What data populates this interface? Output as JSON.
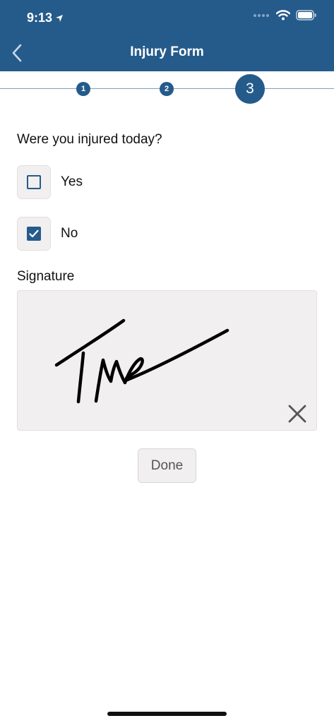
{
  "status_bar": {
    "time": "9:13"
  },
  "nav": {
    "title": "Injury Form"
  },
  "stepper": {
    "steps": [
      "1",
      "2",
      "3"
    ],
    "current_step": 3
  },
  "form": {
    "question": "Were you injured today?",
    "options": [
      {
        "label": "Yes",
        "checked": false
      },
      {
        "label": "No",
        "checked": true
      }
    ],
    "signature_label": "Signature",
    "done_label": "Done"
  },
  "colors": {
    "brand": "#255b8b",
    "field_bg": "#f1efef"
  },
  "icons": {
    "back": "chevron-left-icon",
    "location": "location-arrow-icon",
    "wifi": "wifi-icon",
    "battery": "battery-icon",
    "clear": "close-icon",
    "check": "checkmark-icon"
  }
}
